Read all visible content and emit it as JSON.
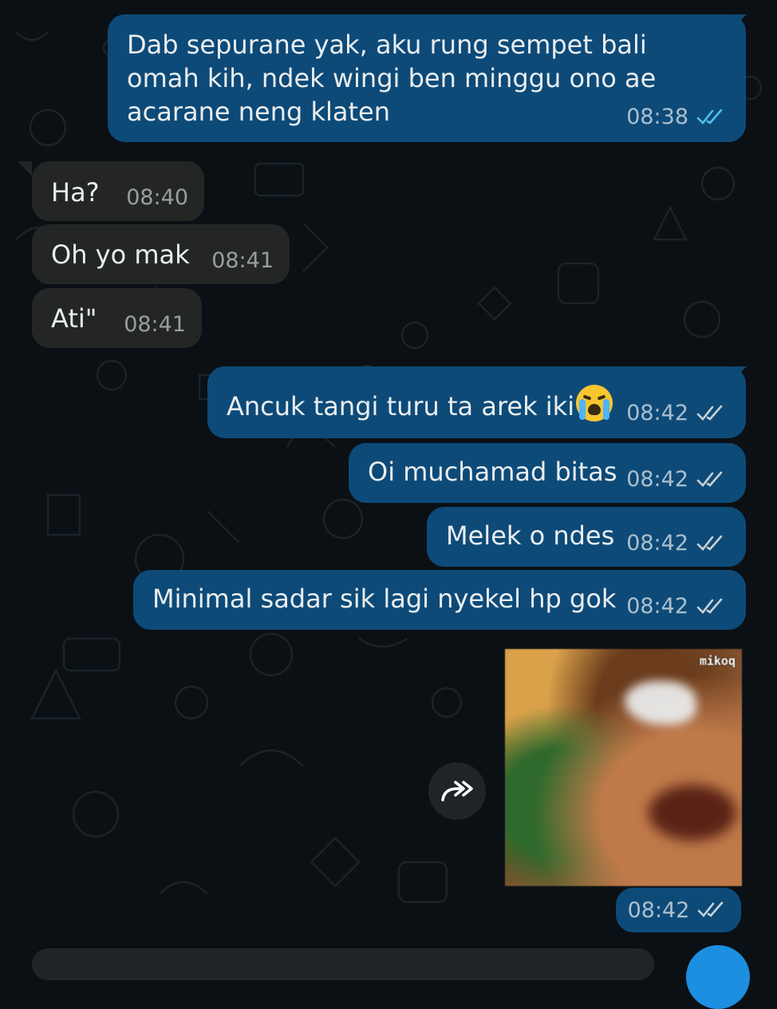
{
  "messages": [
    {
      "direction": "out",
      "text": "Dab sepurane yak, aku rung sempet bali omah kih, ndek wingi ben minggu ono ae acarane neng klaten",
      "time": "08:38",
      "status": "read"
    },
    {
      "direction": "in",
      "text": "Ha?",
      "time": "08:40"
    },
    {
      "direction": "in",
      "text": "Oh yo mak",
      "time": "08:41"
    },
    {
      "direction": "in",
      "text": "Ati\"",
      "time": "08:41"
    },
    {
      "direction": "out",
      "text": "Ancuk tangi turu ta arek iki",
      "emoji": "loudly-crying-face",
      "time": "08:42",
      "status": "delivered"
    },
    {
      "direction": "out",
      "text": "Oi muchamad bitas",
      "time": "08:42",
      "status": "delivered"
    },
    {
      "direction": "out",
      "text": "Melek o ndes",
      "time": "08:42",
      "status": "delivered"
    },
    {
      "direction": "out",
      "text": "Minimal sadar sik lagi nyekel hp gok",
      "time": "08:42",
      "status": "delivered"
    }
  ],
  "sticker": {
    "watermark": "mikoq",
    "time": "08:42",
    "status": "delivered"
  },
  "icons": {
    "tick": "double-check-icon",
    "forward": "forward-icon"
  },
  "colors": {
    "outgoing": "#0d4a78",
    "incoming": "#242626",
    "read_tick": "#53bdeb",
    "delivered_tick": "#c9d1d6"
  }
}
